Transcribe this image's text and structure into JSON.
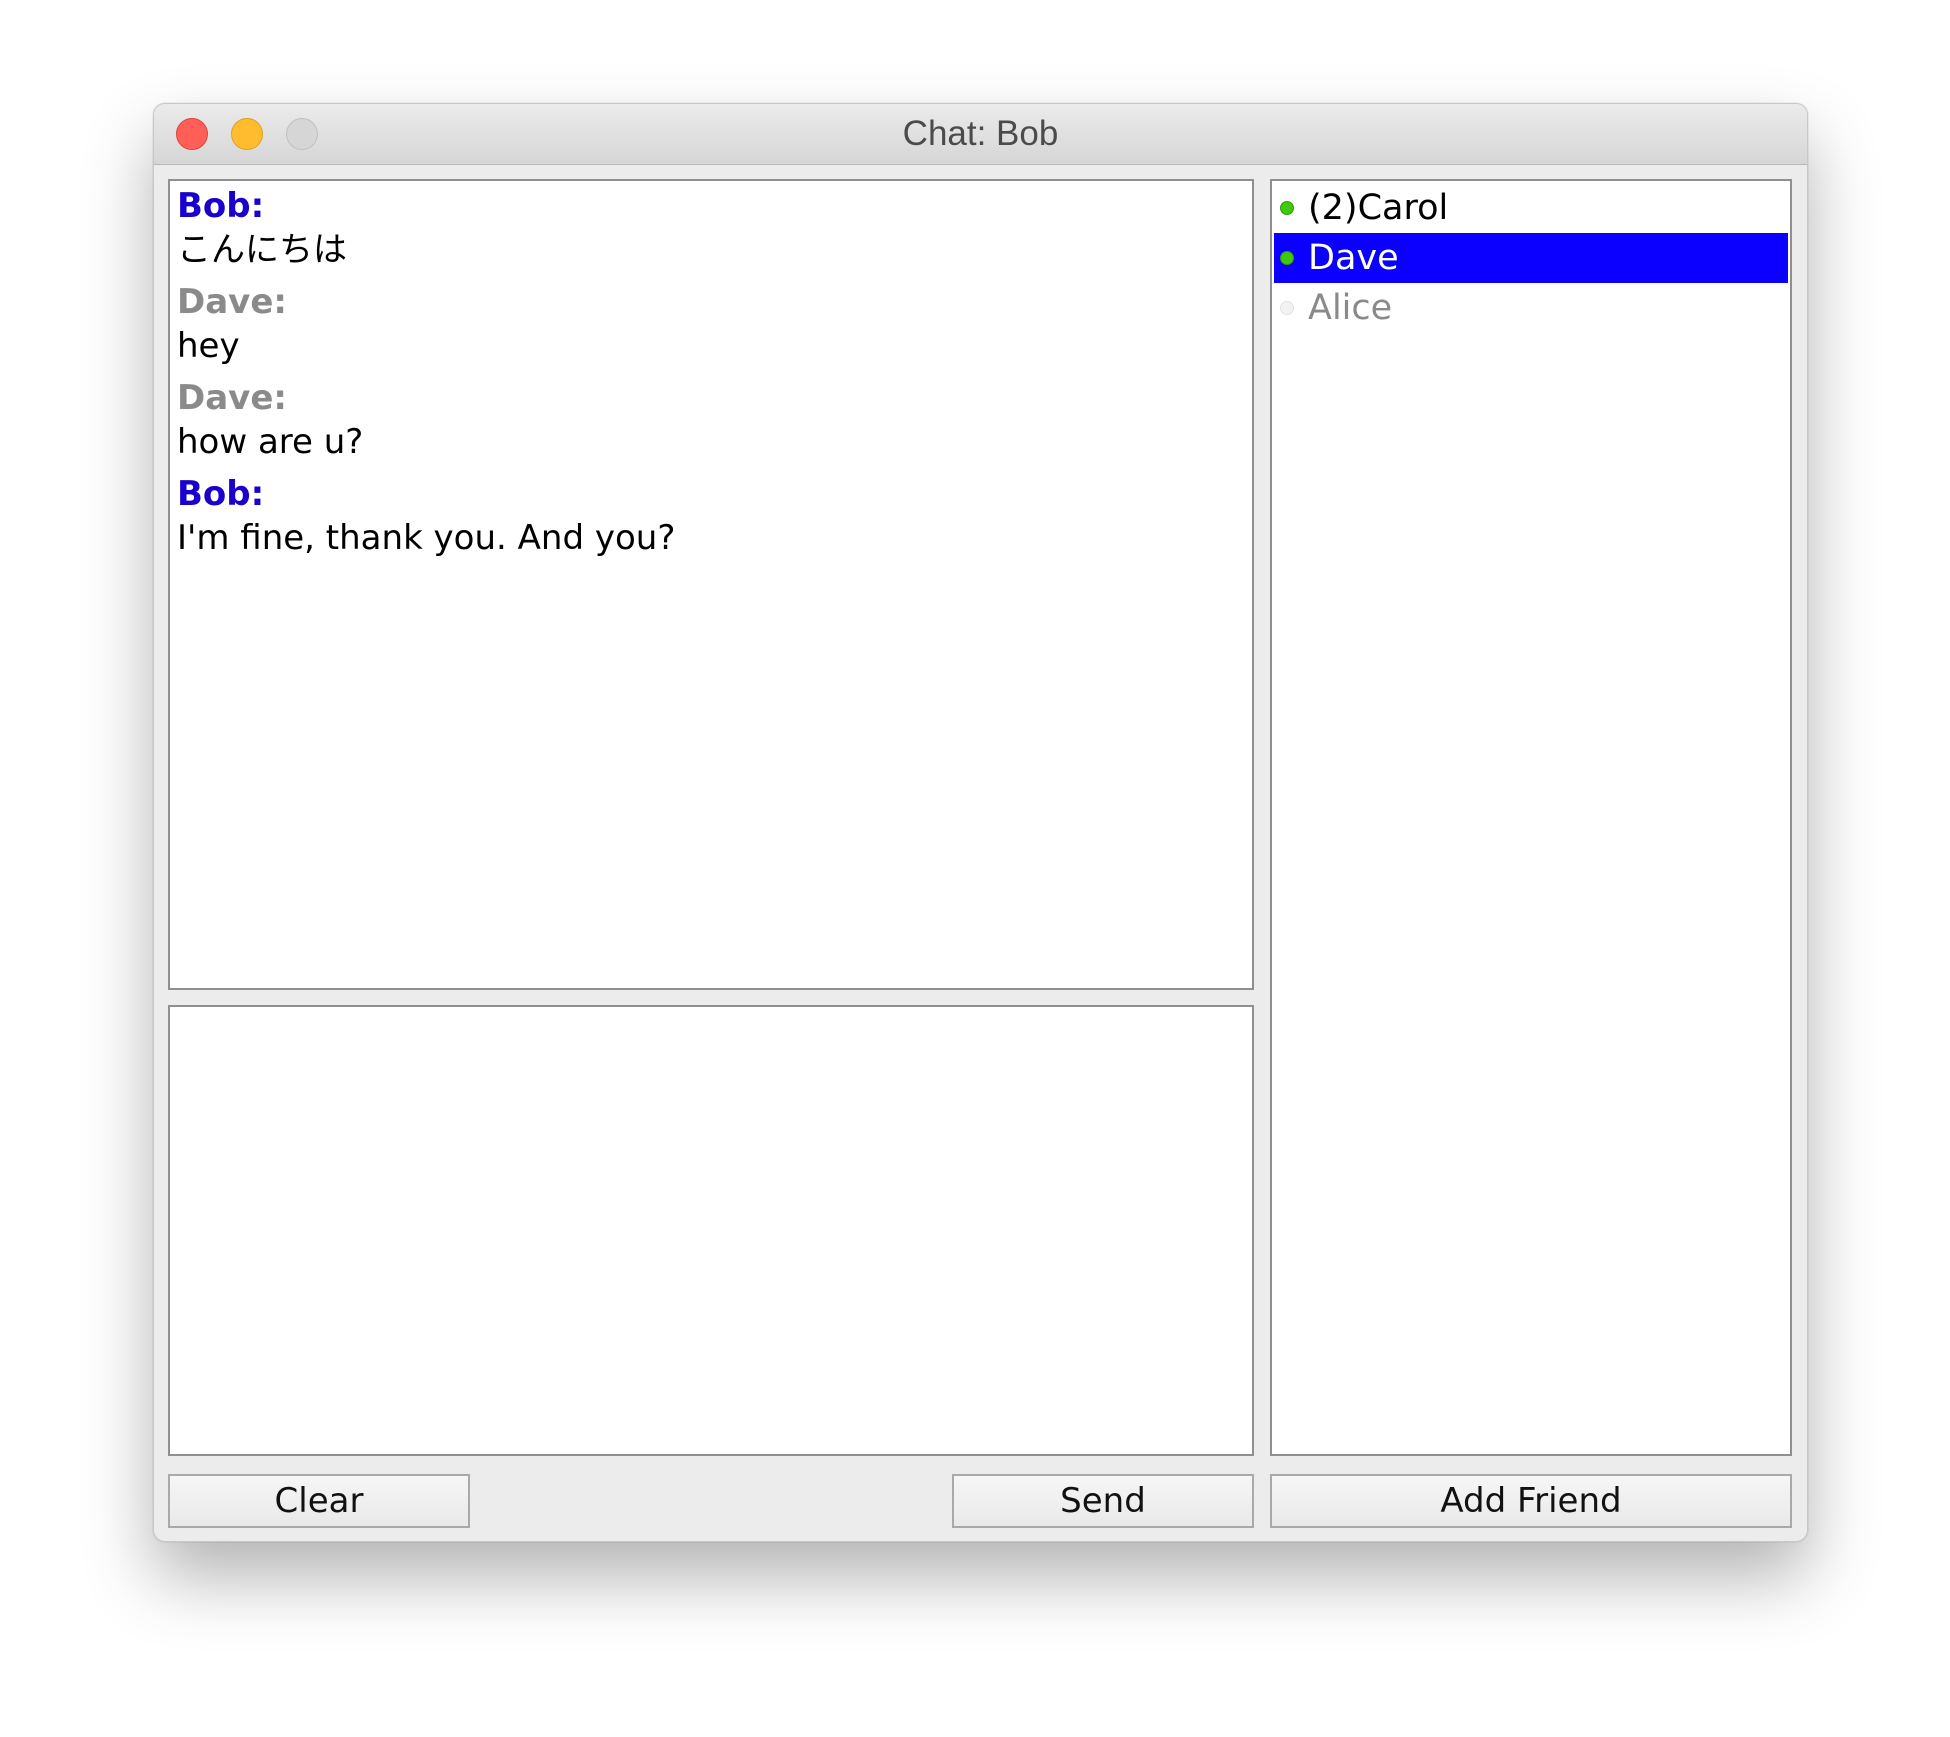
{
  "window": {
    "title": "Chat: Bob"
  },
  "messages": [
    {
      "sender": "Bob:",
      "text": "こんにちは",
      "sender_color": "#1a00cc"
    },
    {
      "sender": "Dave:",
      "text": "hey",
      "sender_color": "#8a8a8a"
    },
    {
      "sender": "Dave:",
      "text": "how are u?",
      "sender_color": "#8a8a8a"
    },
    {
      "sender": "Bob:",
      "text": "I'm fine, thank you. And you?",
      "sender_color": "#1a00cc"
    }
  ],
  "composer": {
    "value": ""
  },
  "friends": [
    {
      "label": "(2)Carol",
      "status": "online",
      "selected": false
    },
    {
      "label": "Dave",
      "status": "online",
      "selected": true
    },
    {
      "label": "Alice",
      "status": "offline",
      "selected": false
    }
  ],
  "buttons": {
    "clear_label": "Clear",
    "send_label": "Send",
    "add_friend_label": "Add Friend"
  },
  "colors": {
    "selection": "#0b00ff",
    "online_dot": "#3ec90a",
    "offline_dot": "#f2f2f2"
  },
  "icons": {
    "online": "status-online-icon",
    "offline": "status-offline-icon"
  }
}
